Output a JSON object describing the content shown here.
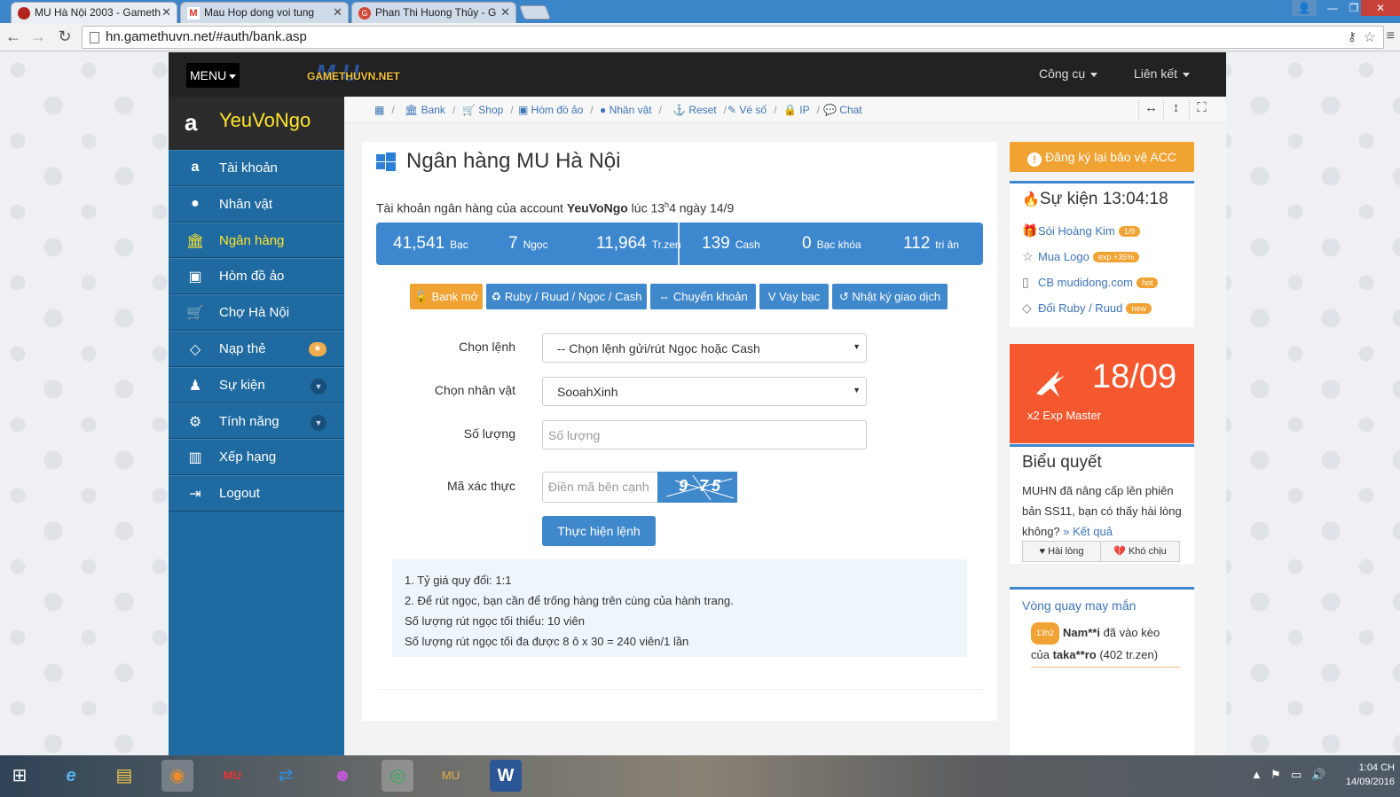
{
  "browser": {
    "tabs": [
      {
        "title": "MU Hà Nội 2003 - Gameth",
        "favicon_color": "#b3261e"
      },
      {
        "title": "Mau Hop dong voi tung",
        "favicon_color": "#d93025"
      },
      {
        "title": "Phan Thi Huong Thủy - G",
        "favicon_color": "#d34836"
      }
    ],
    "url": "hn.gamethuvn.net/#auth/bank.asp"
  },
  "topnav": {
    "menu_label": "MENU",
    "logo_big": "MU",
    "logo_small": "GAMETHUVN.NET",
    "tools_label": "Công cụ",
    "links_label": "Liên kết"
  },
  "sidebar": {
    "username": "YeuVoNgo",
    "items": [
      {
        "label": "Tài khoản",
        "icon": "amazon-icon"
      },
      {
        "label": "Nhân vật",
        "icon": "user-icon"
      },
      {
        "label": "Ngân hàng",
        "icon": "bank-icon",
        "active": true
      },
      {
        "label": "Hòm đồ ảo",
        "icon": "suitcase-icon"
      },
      {
        "label": "Chợ Hà Nội",
        "icon": "cart-icon"
      },
      {
        "label": "Nạp thẻ",
        "icon": "diamond-icon",
        "badge": "star"
      },
      {
        "label": "Sự kiện",
        "icon": "android-icon",
        "expand": true
      },
      {
        "label": "Tính năng",
        "icon": "cogs-icon",
        "expand": true
      },
      {
        "label": "Xếp hạng",
        "icon": "bar-chart-icon"
      },
      {
        "label": "Logout",
        "icon": "sign-out-icon"
      }
    ]
  },
  "breadcrumbs": [
    "Bank",
    "Shop",
    "Hòm đồ ảo",
    "Nhân vật",
    "Reset",
    "Vé số",
    "IP",
    "Chat"
  ],
  "main": {
    "title": "Ngân hàng MU Hà Nội",
    "account_prefix": "Tài khoản ngân hàng của account ",
    "account_name": "YeuVoNgo",
    "account_time": " lúc 13",
    "account_sup": "h",
    "account_suffix": "4 ngày 14/9",
    "balances": [
      {
        "value": "41,541",
        "unit": "Bạc"
      },
      {
        "value": "7",
        "unit": "Ngọc"
      },
      {
        "value": "11,964",
        "unit": "Tr.zen"
      },
      {
        "value": "139",
        "unit": "Cash"
      },
      {
        "value": "0",
        "unit": "Bạc khóa"
      },
      {
        "value": "112",
        "unit": "tri ân"
      }
    ],
    "buttons": [
      "Bank mở",
      "Ruby / Ruud / Ngọc / Cash",
      "Chuyển khoản",
      "Vay bạc",
      "Nhật ký giao dịch"
    ],
    "form": {
      "command_label": "Chọn lệnh",
      "command_value": "-- Chọn lệnh gửi/rút Ngọc hoặc Cash",
      "character_label": "Chọn nhân vật",
      "character_value": "SooahXinh",
      "amount_label": "Số lượng",
      "amount_placeholder": "Số lượng",
      "captcha_label": "Mã xác thực",
      "captcha_placeholder": "Điền mã bên cạnh",
      "captcha_text": "9 75",
      "submit_label": "Thực hiện lệnh"
    },
    "notes": [
      "1. Tỷ giá quy đổi: 1:1",
      "2. Để rút ngọc, bạn cần để trống hàng trên cùng của hành trang.",
      "Số lượng rút ngọc tối thiểu: 10 viên",
      "Số lượng rút ngọc tối đa được 8 ô x 30 = 240 viên/1 lần"
    ]
  },
  "right": {
    "warning_label": "Đăng ký lại bảo vệ ACC",
    "events_title": "Sự kiện 13:04:18",
    "events": [
      {
        "label": "Sói Hoàng Kim",
        "badge": "1/9",
        "icon": "gift-icon"
      },
      {
        "label": "Mua Logo",
        "badge": "exp +35%",
        "icon": "star-icon"
      },
      {
        "label": "CB mudidong.com",
        "badge": "hot",
        "icon": "mobile-icon"
      },
      {
        "label": "Đổi Ruby / Ruud",
        "badge": "new",
        "icon": "diamond-icon"
      }
    ],
    "promo_date": "18/09",
    "promo_text": "x2 Exp Master",
    "poll_title": "Biểu quyết",
    "poll_text": "MUHN đã nâng cấp lên phiên bản SS11, bạn có thấy hài lòng không?",
    "poll_link": "» Kết quả",
    "poll_yes": "Hài lòng",
    "poll_no": "Khó chịu",
    "wheel_title": "Vòng quay may mắn",
    "wheel_time": "13h2",
    "wheel_user": "Nam**i",
    "wheel_mid": " đã vào kèo",
    "wheel_of": "của ",
    "wheel_user2": "taka**ro",
    "wheel_amount": " (402",
    "wheel_unit": " tr.zen)"
  },
  "taskbar": {
    "clock_time": "1:04 CH",
    "clock_date": "14/09/2016"
  }
}
